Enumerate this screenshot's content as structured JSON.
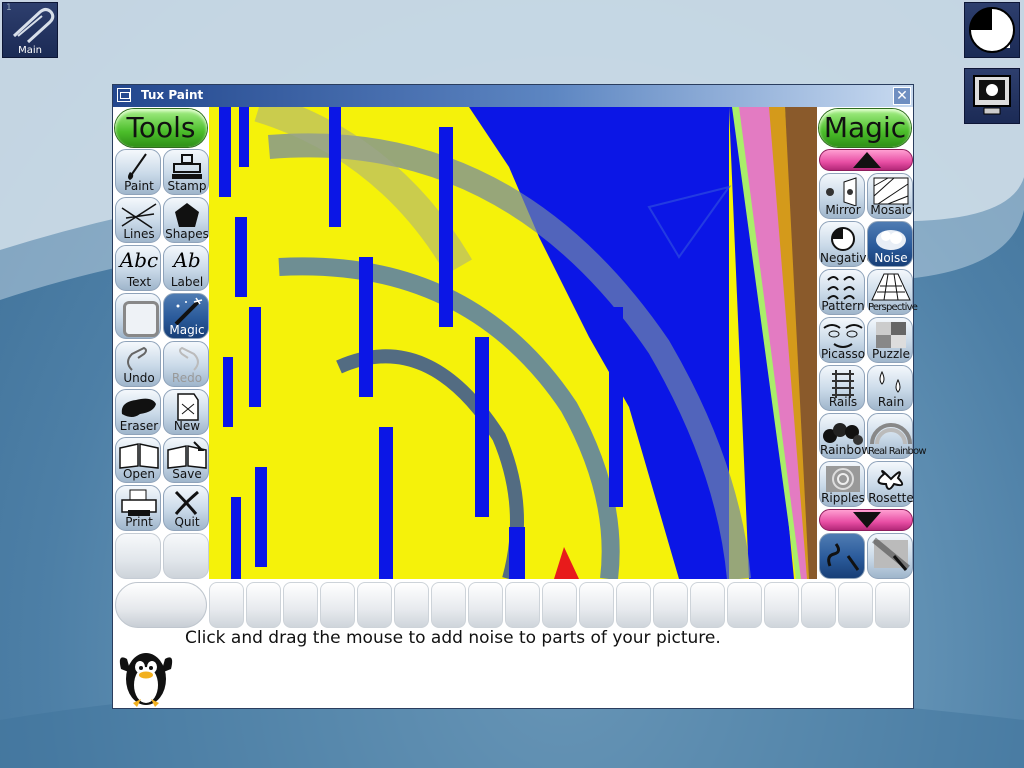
{
  "desktop": {
    "main_icon_label": "Main",
    "main_icon_number": "1"
  },
  "window": {
    "title": "Tux Paint",
    "close_glyph": "✕"
  },
  "tools": {
    "header": "Tools",
    "items": [
      {
        "label": "Paint",
        "icon": "paint-brush-icon"
      },
      {
        "label": "Stamp",
        "icon": "stamp-icon"
      },
      {
        "label": "Lines",
        "icon": "lines-icon"
      },
      {
        "label": "Shapes",
        "icon": "pentagon-icon"
      },
      {
        "label": "Text",
        "icon": "text-abc-icon",
        "glyph": "Abc"
      },
      {
        "label": "Label",
        "icon": "label-abc-icon",
        "glyph": "Ab"
      },
      {
        "label": "",
        "icon": "fill-placeholder-icon"
      },
      {
        "label": "Magic",
        "icon": "magic-wand-icon",
        "selected": true
      },
      {
        "label": "Undo",
        "icon": "undo-icon"
      },
      {
        "label": "Redo",
        "icon": "redo-icon",
        "disabled": true
      },
      {
        "label": "Eraser",
        "icon": "eraser-icon"
      },
      {
        "label": "New",
        "icon": "new-page-icon"
      },
      {
        "label": "Open",
        "icon": "open-book-icon"
      },
      {
        "label": "Save",
        "icon": "save-icon"
      },
      {
        "label": "Print",
        "icon": "printer-icon"
      },
      {
        "label": "Quit",
        "icon": "quit-x-icon"
      }
    ]
  },
  "magic": {
    "header": "Magic",
    "items": [
      {
        "label": "Mirror",
        "icon": "mirror-icon"
      },
      {
        "label": "Mosaic",
        "icon": "mosaic-icon"
      },
      {
        "label": "Negative",
        "icon": "negative-icon"
      },
      {
        "label": "Noise",
        "icon": "noise-icon",
        "selected": true
      },
      {
        "label": "Pattern",
        "icon": "pattern-icon"
      },
      {
        "label": "Perspective",
        "icon": "perspective-icon"
      },
      {
        "label": "Picasso",
        "icon": "picasso-icon"
      },
      {
        "label": "Puzzle",
        "icon": "puzzle-icon"
      },
      {
        "label": "Rails",
        "icon": "rails-icon"
      },
      {
        "label": "Rain",
        "icon": "rain-icon"
      },
      {
        "label": "Rainbow",
        "icon": "rainbow-icon"
      },
      {
        "label": "Real Rainbow",
        "icon": "real-rainbow-icon"
      },
      {
        "label": "Ripples",
        "icon": "ripples-icon"
      },
      {
        "label": "Rosette",
        "icon": "rosette-icon"
      }
    ]
  },
  "status": {
    "instruction": "Click and drag the mouse to add noise to parts of your picture."
  },
  "colors": {
    "canvas_yellow": "#f5f20a",
    "canvas_blue": "#0b16e6",
    "canvas_pink": "#e37bc2",
    "canvas_brown": "#8a5a2b",
    "header_green": "#4bbd2a",
    "scroll_pink": "#e84ea4",
    "selected_blue": "#2a5a9a"
  }
}
